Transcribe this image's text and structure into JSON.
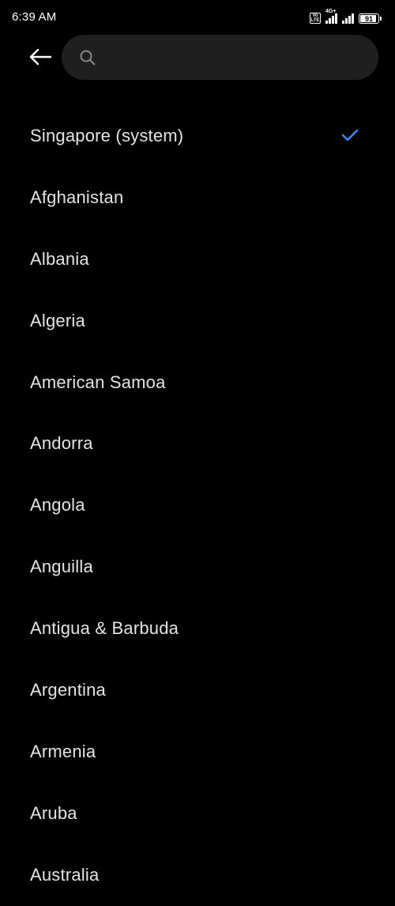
{
  "status_bar": {
    "time": "6:39 AM",
    "volte_top": "Vo",
    "volte_bottom": "LTE",
    "network_type": "4G+",
    "battery_level": "91",
    "battery_fraction": 0.91
  },
  "header": {
    "back_icon": "arrow-left-icon",
    "search_icon": "search-icon",
    "search_value": "",
    "search_placeholder": ""
  },
  "regions": [
    {
      "label": "Singapore (system)",
      "selected": true
    },
    {
      "label": "Afghanistan",
      "selected": false
    },
    {
      "label": "Albania",
      "selected": false
    },
    {
      "label": "Algeria",
      "selected": false
    },
    {
      "label": "American Samoa",
      "selected": false
    },
    {
      "label": "Andorra",
      "selected": false
    },
    {
      "label": "Angola",
      "selected": false
    },
    {
      "label": "Anguilla",
      "selected": false
    },
    {
      "label": "Antigua & Barbuda",
      "selected": false
    },
    {
      "label": "Argentina",
      "selected": false
    },
    {
      "label": "Armenia",
      "selected": false
    },
    {
      "label": "Aruba",
      "selected": false
    },
    {
      "label": "Australia",
      "selected": false
    }
  ],
  "colors": {
    "background": "#000000",
    "search_background": "#1f1f1f",
    "accent": "#3a86ff",
    "text": "#e4e4e4"
  }
}
